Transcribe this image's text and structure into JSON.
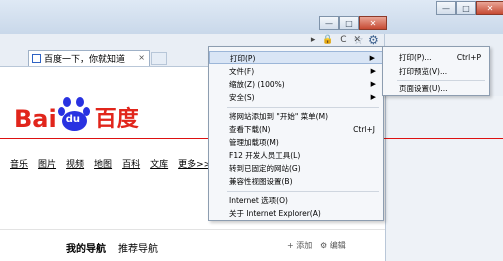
{
  "window": {
    "controls": {
      "minimize": "—",
      "maximize": "□",
      "close": "✕"
    },
    "controls2": {
      "minimize": "—",
      "maximize": "□",
      "close": "✕"
    }
  },
  "address": {
    "icons": "▸ 🔒 C ✕"
  },
  "tab": {
    "title": "百度一下，你就知道",
    "close": "×"
  },
  "logo": {
    "bai": "Bai",
    "du": "du",
    "cn": "百度"
  },
  "nav": [
    "音乐",
    "图片",
    "视频",
    "地图",
    "百科",
    "文库",
    "更多>>"
  ],
  "bottom_tabs": {
    "my_nav": "我的导航",
    "recommend": "推荐导航",
    "add": "+ 添加",
    "edit": "⚙ 编辑"
  },
  "menu": {
    "items": [
      {
        "label": "打印(P)",
        "arrow": "▶"
      },
      {
        "label": "文件(F)",
        "arrow": "▶"
      },
      {
        "label": "缩放(Z) (100%)",
        "arrow": "▶"
      },
      {
        "label": "安全(S)",
        "arrow": "▶"
      },
      {
        "label": "将网站添加到 \"开始\" 菜单(M)"
      },
      {
        "label": "查看下载(N)",
        "shortcut": "Ctrl+J"
      },
      {
        "label": "管理加载项(M)"
      },
      {
        "label": "F12 开发人员工具(L)"
      },
      {
        "label": "转到已固定的网站(G)"
      },
      {
        "label": "兼容性视图设置(B)"
      },
      {
        "label": "Internet 选项(O)"
      },
      {
        "label": "关于 Internet Explorer(A)"
      }
    ]
  },
  "submenu": {
    "items": [
      {
        "label": "打印(P)...",
        "shortcut": "Ctrl+P"
      },
      {
        "label": "打印预览(V)..."
      },
      {
        "label": "页面设置(U)..."
      }
    ]
  }
}
